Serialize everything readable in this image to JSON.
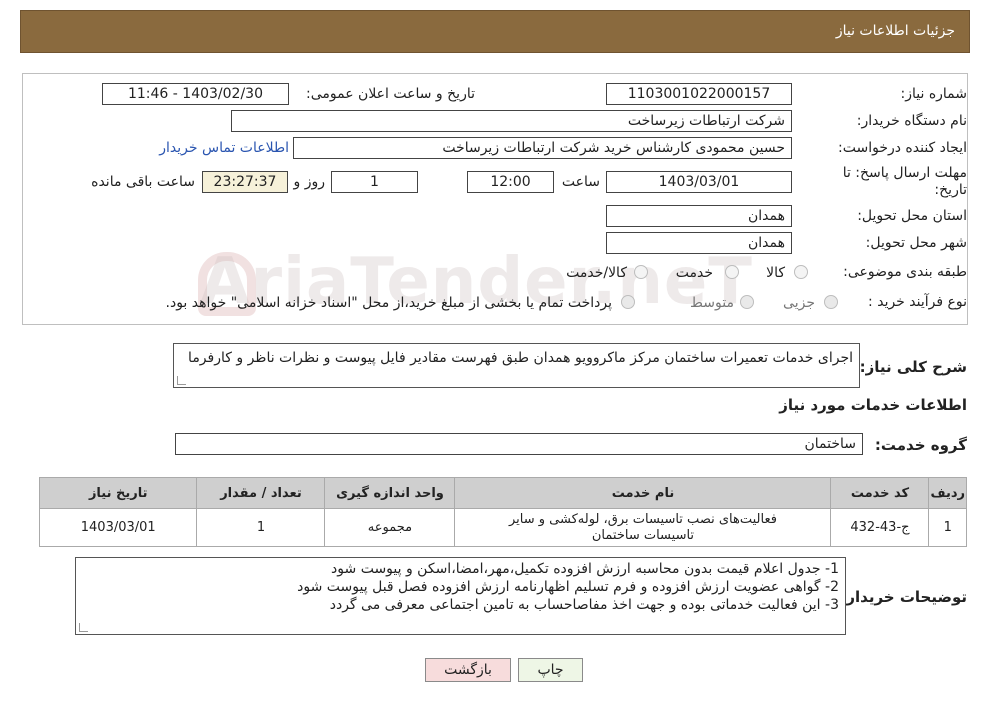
{
  "header": {
    "title": "جزئیات اطلاعات نیاز"
  },
  "form": {
    "need_number_label": "شماره نیاز:",
    "need_number": "1103001022000157",
    "announce_label": "تاریخ و ساعت اعلان عمومی:",
    "announce_value": "1403/02/30 - 11:46",
    "buyer_org_label": "نام دستگاه خریدار:",
    "buyer_org": "شرکت ارتباطات زیرساخت",
    "requester_label": "ایجاد کننده درخواست:",
    "requester": "حسین محمودی کارشناس خرید شرکت ارتباطات زیرساخت",
    "contact_link": "اطلاعات تماس خریدار",
    "deadline_label_1": "مهلت ارسال پاسخ: تا",
    "deadline_label_2": "تاریخ:",
    "deadline_date": "1403/03/01",
    "time_label": "ساعت",
    "deadline_time": "12:00",
    "days_value": "1",
    "days_label": "روز و",
    "remaining_time": "23:27:37",
    "remaining_label": "ساعت باقی مانده",
    "province_label": "استان محل تحویل:",
    "province": "همدان",
    "city_label": "شهر محل تحویل:",
    "city": "همدان",
    "category_label": "طبقه بندی موضوعی:",
    "category_options": [
      "کالا",
      "خدمت",
      "کالا/خدمت"
    ],
    "process_label": "نوع فرآیند خرید :",
    "process_options": [
      "جزیی",
      "متوسط"
    ],
    "process_note": "پرداخت تمام یا بخشی از مبلغ خرید،از محل \"اسناد خزانه اسلامی\" خواهد بود."
  },
  "description": {
    "label": "شرح کلی نیاز:",
    "text": "اجرای خدمات تعمیرات ساختمان مرکز ماکروویو همدان طبق فهرست مقادیر فایل پیوست و نظرات ناظر و کارفرما"
  },
  "services": {
    "section_title": "اطلاعات خدمات مورد نیاز",
    "group_label": "گروه خدمت:",
    "group_value": "ساختمان",
    "columns": [
      "ردیف",
      "کد خدمت",
      "نام خدمت",
      "واحد اندازه گیری",
      "تعداد / مقدار",
      "تاریخ نیاز"
    ],
    "rows": [
      {
        "row": "1",
        "code": "ج-43-432",
        "name": "فعالیت‌های نصب تاسیسات برق، لوله‌کشی و سایر تاسیسات ساختمان",
        "unit": "مجموعه",
        "qty": "1",
        "date": "1403/03/01"
      }
    ]
  },
  "buyer_notes": {
    "label": "توضیحات خریدار:",
    "lines": [
      "1- جدول اعلام قیمت بدون محاسبه ارزش افزوده تکمیل،مهر،امضا،اسکن و پیوست شود",
      "2- گواهی عضویت ارزش افزوده و فرم تسلیم اظهارنامه ارزش افزوده فصل قبل پیوست شود",
      "3- این فعالیت  خدماتی بوده و جهت اخذ مفاصاحساب به تامین اجتماعی معرفی می گردد"
    ]
  },
  "buttons": {
    "print": "چاپ",
    "back": "بازگشت"
  },
  "watermark": "AriaTender.neT",
  "colors": {
    "header_bg": "#8a6a3e",
    "timer_bg": "#f6f1d9",
    "link": "#2a55b0",
    "back_btn": "#f7dcdc",
    "print_btn": "#eef6e6"
  }
}
